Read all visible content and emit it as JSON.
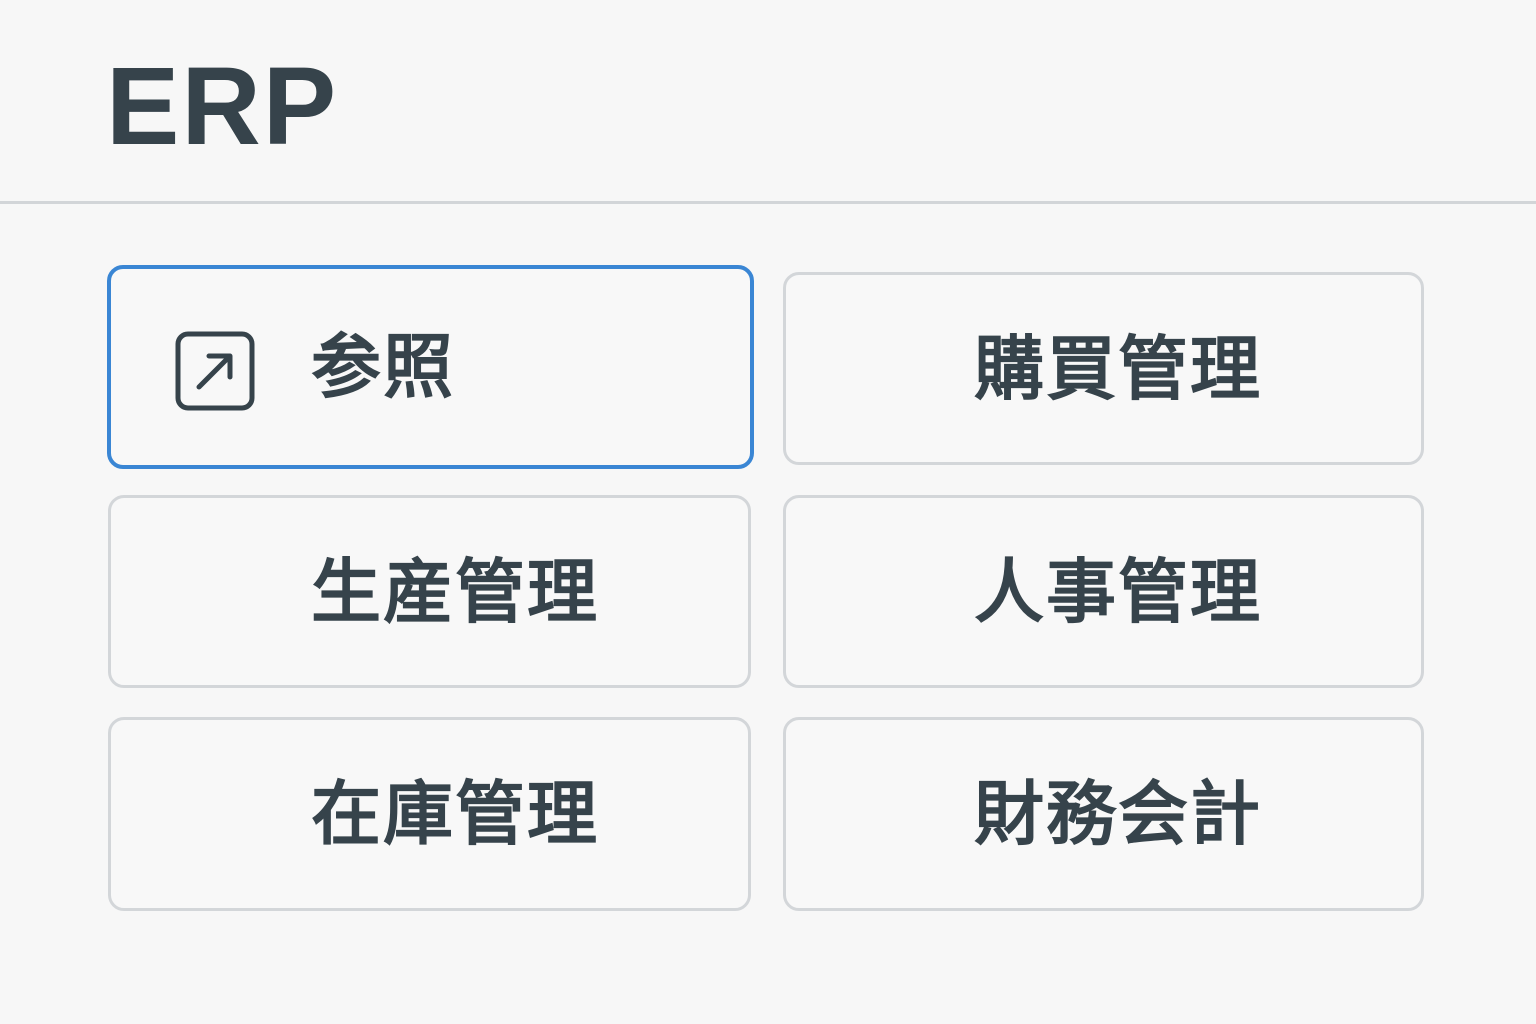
{
  "header": {
    "title": "ERP"
  },
  "colors": {
    "text": "#36434b",
    "selected_border": "#3a86d4",
    "tile_border": "#d3d6d9",
    "background": "#f7f7f7"
  },
  "tiles": [
    {
      "label": "参照",
      "icon": "open-external-icon",
      "selected": true
    },
    {
      "label": "購買管理",
      "selected": false
    },
    {
      "label": "生産管理",
      "selected": false
    },
    {
      "label": "人事管理",
      "selected": false
    },
    {
      "label": "在庫管理",
      "selected": false
    },
    {
      "label": "財務会計",
      "selected": false
    }
  ]
}
